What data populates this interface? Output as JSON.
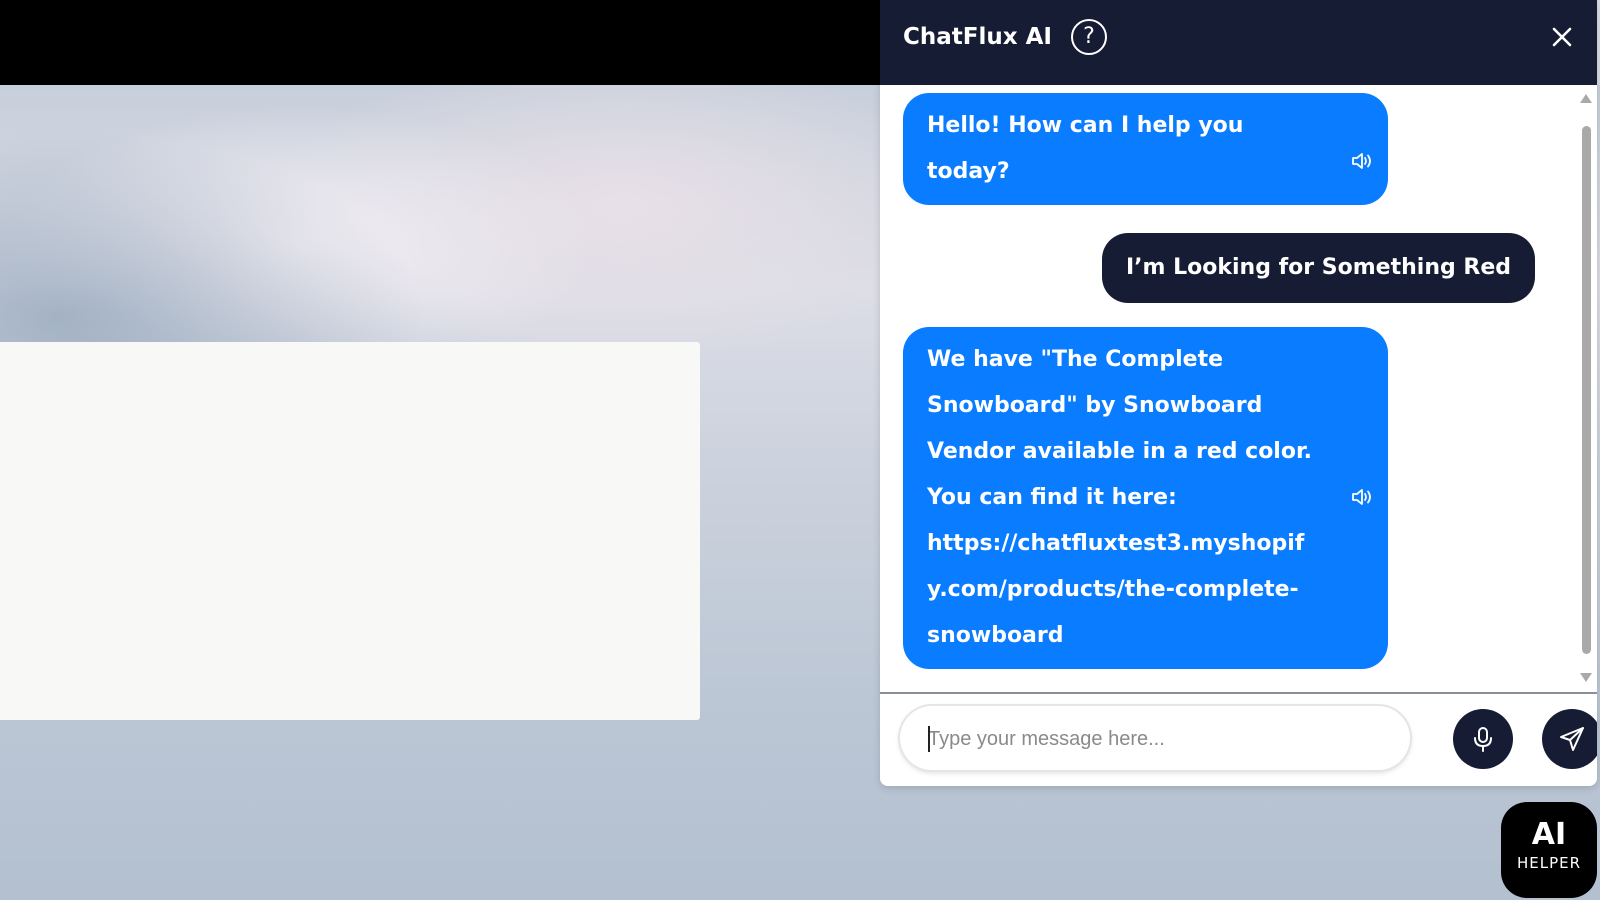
{
  "chat": {
    "title": "ChatFlux AI",
    "help_icon": "question-circle-icon",
    "close_icon": "close-icon",
    "messages": [
      {
        "role": "bot",
        "text": "Hello! How can I help you today?"
      },
      {
        "role": "user",
        "text": "I’m Looking for Something Red"
      },
      {
        "role": "bot",
        "text": "We have \"The Complete Snowboard\" by Snowboard Vendor available in a red color. You can find it here: https://chatfluxtest3.myshopify.com/products/the-complete-snowboard"
      }
    ],
    "input": {
      "placeholder": "Type your message here...",
      "value": ""
    },
    "mic_icon": "microphone-icon",
    "send_icon": "send-icon"
  },
  "ai_helper": {
    "title": "AI",
    "subtitle": "HELPER"
  },
  "colors": {
    "header": "#161c33",
    "bot_bubble": "#0a7cff",
    "user_bubble": "#161c33"
  }
}
